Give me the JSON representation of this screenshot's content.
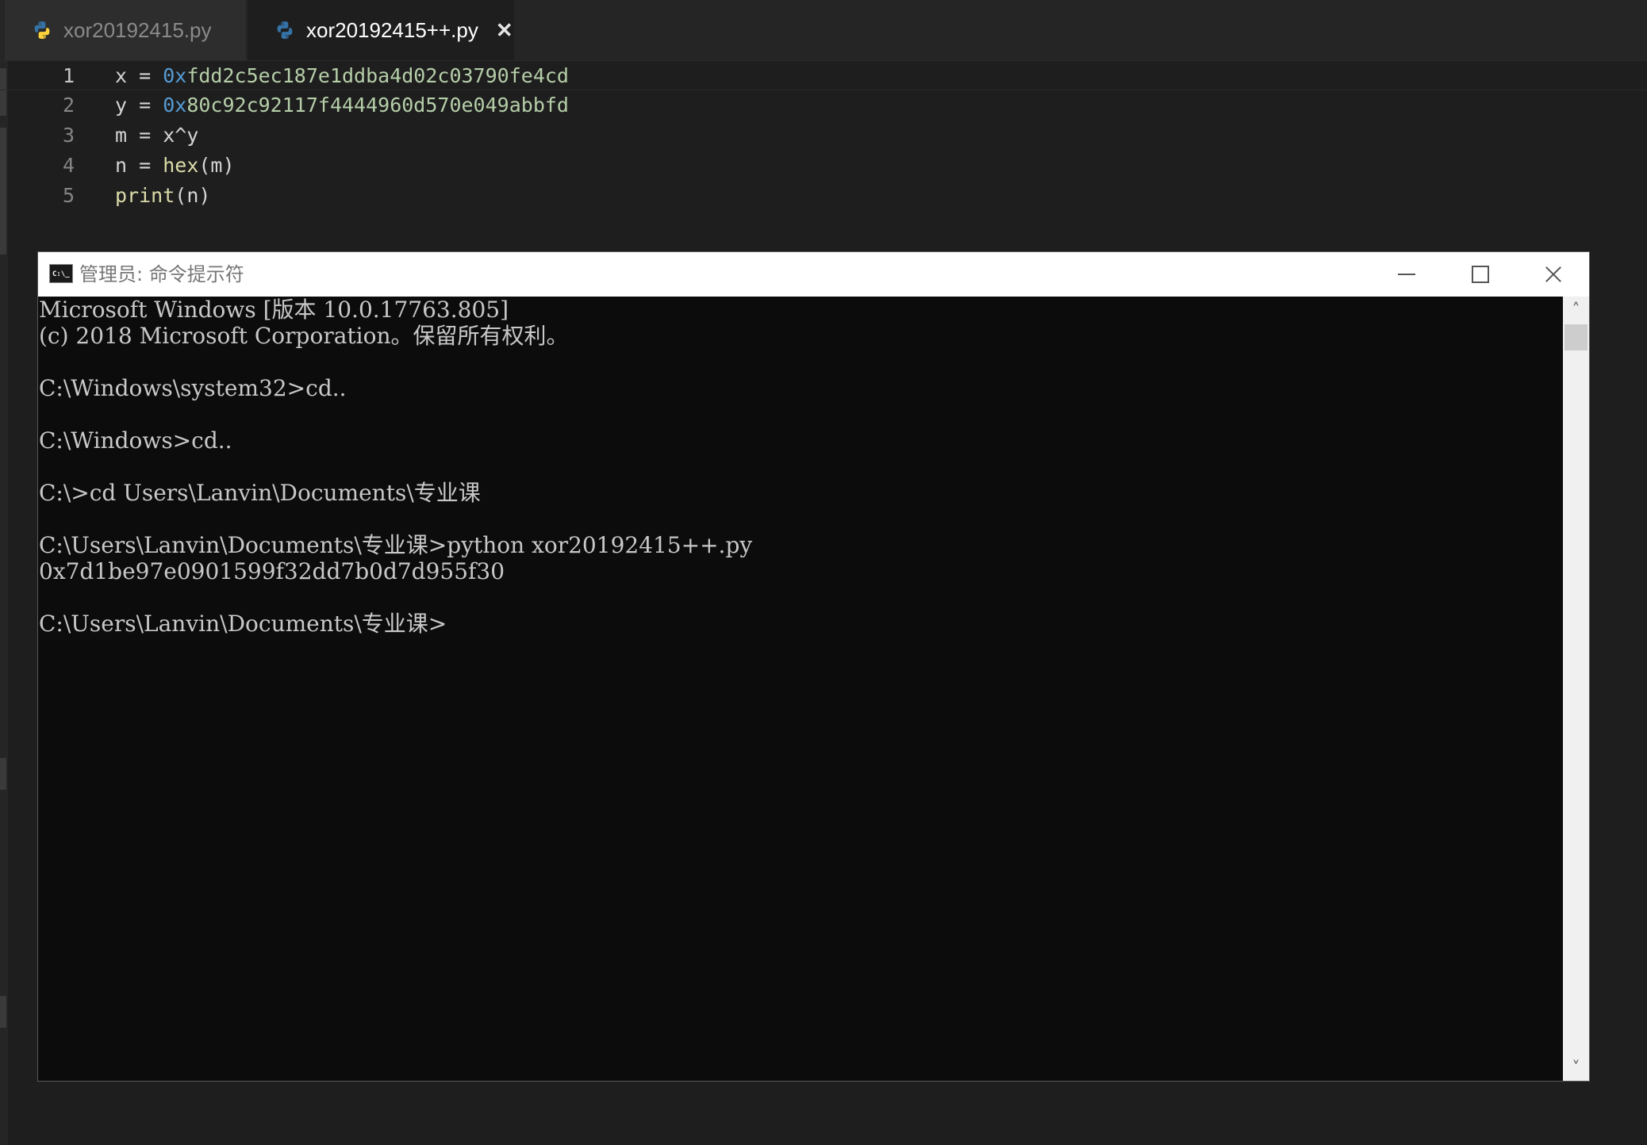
{
  "editor": {
    "tabs": [
      {
        "label": "xor20192415.py",
        "active": false
      },
      {
        "label": "xor20192415++.py",
        "active": true,
        "close": "✕"
      }
    ],
    "lines": [
      {
        "number": "1",
        "tokens": [
          {
            "t": "x = ",
            "c": "plain"
          },
          {
            "t": "0x",
            "c": "num0x"
          },
          {
            "t": "fdd2c5ec187e1ddba4d02c03790fe4cd",
            "c": "numhex"
          }
        ]
      },
      {
        "number": "2",
        "tokens": [
          {
            "t": "y = ",
            "c": "plain"
          },
          {
            "t": "0x",
            "c": "num0x"
          },
          {
            "t": "80c92c92117f4444960d570e049abbfd",
            "c": "numhex"
          }
        ]
      },
      {
        "number": "3",
        "tokens": [
          {
            "t": "m = x^y",
            "c": "plain"
          }
        ]
      },
      {
        "number": "4",
        "tokens": [
          {
            "t": "n = ",
            "c": "plain"
          },
          {
            "t": "hex",
            "c": "fn"
          },
          {
            "t": "(m)",
            "c": "plain"
          }
        ]
      },
      {
        "number": "5",
        "tokens": [
          {
            "t": "print",
            "c": "fn"
          },
          {
            "t": "(n)",
            "c": "plain"
          }
        ]
      }
    ]
  },
  "cmd": {
    "title": "管理员: 命令提示符",
    "icon_label": "C:\\_",
    "scroll_up": "˄",
    "scroll_down": "˅",
    "lines": [
      "Microsoft Windows [版本 10.0.17763.805]",
      "(c) 2018 Microsoft Corporation。保留所有权利。",
      "",
      "C:\\Windows\\system32>cd..",
      "",
      "C:\\Windows>cd..",
      "",
      "C:\\>cd Users\\Lanvin\\Documents\\专业课",
      "",
      "C:\\Users\\Lanvin\\Documents\\专业课>python xor20192415++.py",
      "0x7d1be97e0901599f32dd7b0d7d955f30",
      "",
      "C:\\Users\\Lanvin\\Documents\\专业课>"
    ]
  },
  "icons": {
    "tab_file_icon": "python-file-icon",
    "cmd_icon": "cmd-icon"
  },
  "colors": {
    "python_blue": "#3572A5",
    "python_yellow": "#FFD43B"
  }
}
